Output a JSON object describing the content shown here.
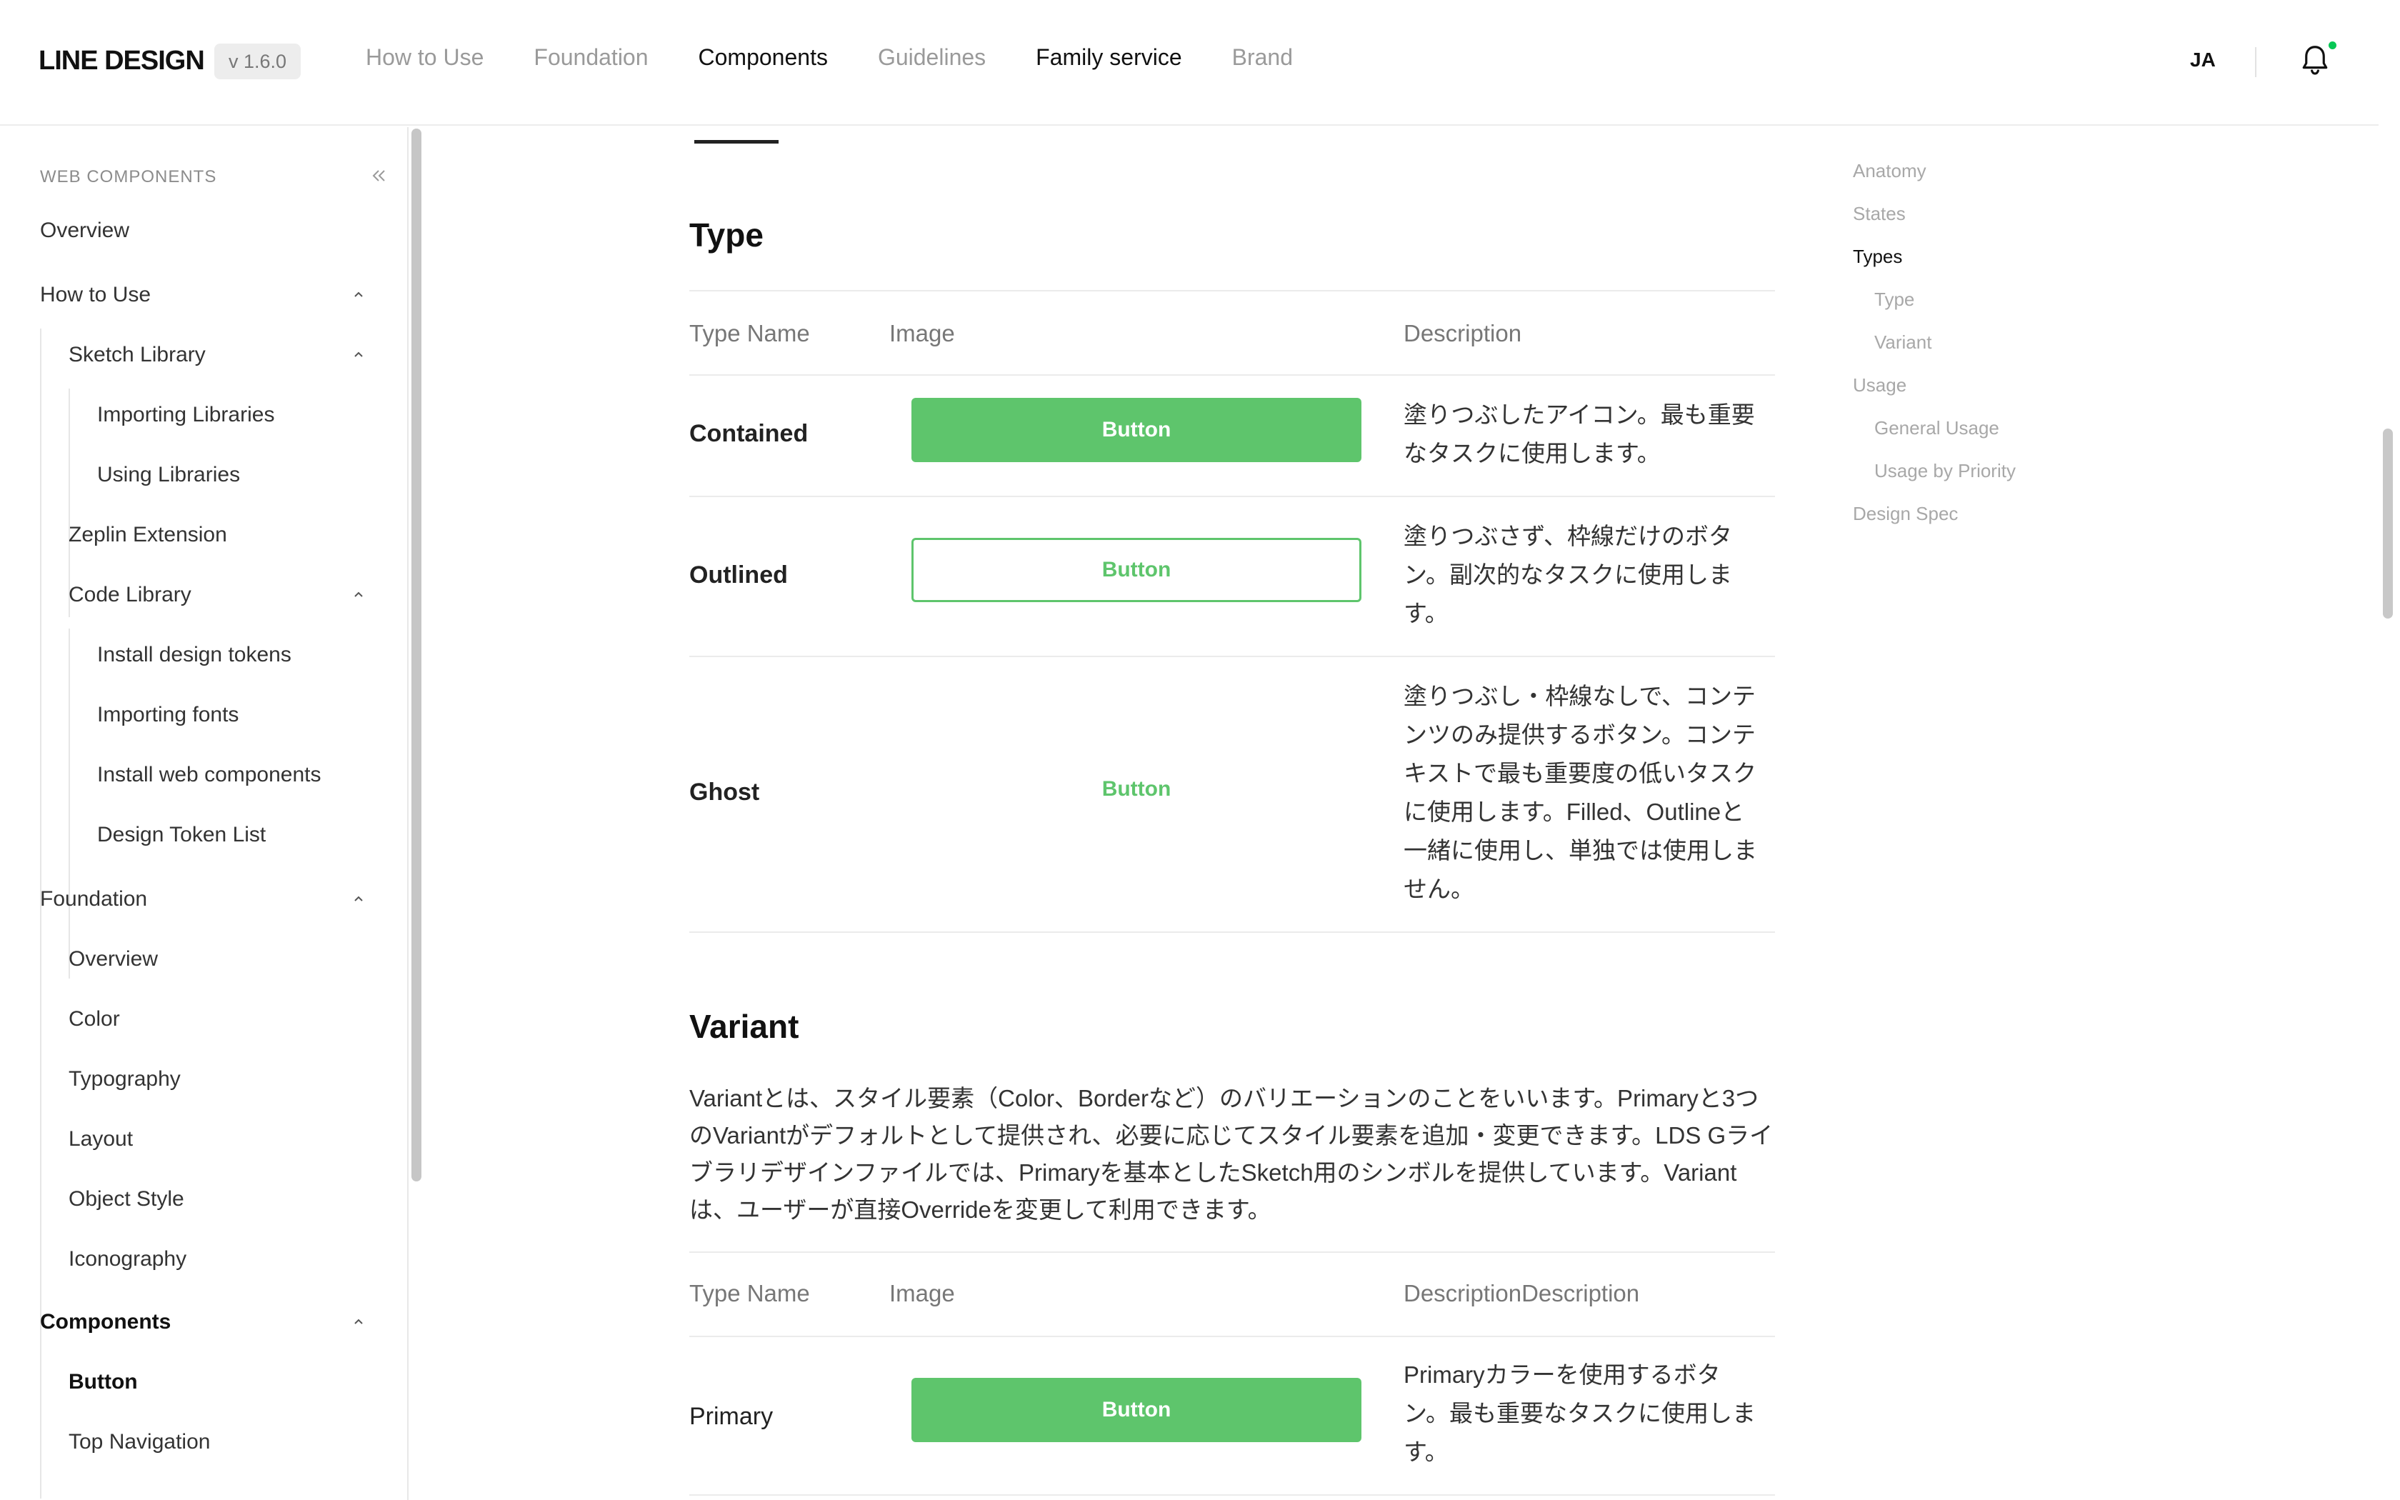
{
  "header": {
    "logo": "LINE DESIGN",
    "version": "v 1.6.0",
    "nav": [
      {
        "label": "How to Use",
        "active": false
      },
      {
        "label": "Foundation",
        "active": false
      },
      {
        "label": "Components",
        "active": true
      },
      {
        "label": "Guidelines",
        "active": false
      },
      {
        "label": "Family service",
        "active": true
      },
      {
        "label": "Brand",
        "active": false
      }
    ],
    "lang": "JA",
    "notification_icon": "bell-icon"
  },
  "sidebar": {
    "title": "WEB COMPONENTS",
    "collapse_icon": "double-chevron-left-icon",
    "items": {
      "overview": "Overview",
      "how_to_use": "How to Use",
      "sketch_library": "Sketch Library",
      "importing_libraries": "Importing Libraries",
      "using_libraries": "Using Libraries",
      "zeplin_extension": "Zeplin Extension",
      "code_library": "Code Library",
      "install_design_tokens": "Install design tokens",
      "importing_fonts": "Importing fonts",
      "install_web_components": "Install web components",
      "design_token_list": "Design Token List",
      "foundation": "Foundation",
      "f_overview": "Overview",
      "color": "Color",
      "typography": "Typography",
      "layout": "Layout",
      "object_style": "Object Style",
      "iconography": "Iconography",
      "components": "Components",
      "button": "Button",
      "top_navigation": "Top Navigation"
    }
  },
  "type_section": {
    "title": "Type",
    "headers": {
      "name": "Type Name",
      "image": "Image",
      "description": "Description"
    },
    "rows": [
      {
        "name": "Contained",
        "button": "Button",
        "description": "塗りつぶしたアイコン。最も重要なタスクに使用します。"
      },
      {
        "name": "Outlined",
        "button": "Button",
        "description": "塗りつぶさず、枠線だけのボタン。副次的なタスクに使用します。"
      },
      {
        "name": "Ghost",
        "button": "Button",
        "description": "塗りつぶし・枠線なしで、コンテンツのみ提供するボタン。コンテキストで最も重要度の低いタスクに使用します。Filled、Outlineと一緒に使用し、単独では使用しません。"
      }
    ]
  },
  "variant_section": {
    "title": "Variant",
    "paragraph": "Variantとは、スタイル要素（Color、Borderなど）のバリエーションのことをいいます。Primaryと3つのVariantがデフォルトとして提供され、必要に応じてスタイル要素を追加・変更できます。LDS Gライブラリデザインファイルでは、Primaryを基本としたSketch用のシンボルを提供しています。Variantは、ユーザーが直接Overrideを変更して利用できます。",
    "headers": {
      "name": "Type Name",
      "image": "Image",
      "description": "DescriptionDescription"
    },
    "rows": [
      {
        "name": "Primary",
        "button": "Button",
        "description": "Primaryカラーを使用するボタン。最も重要なタスクに使用します。"
      }
    ]
  },
  "toc": {
    "items": [
      {
        "label": "Anatomy",
        "active": false,
        "indent": false
      },
      {
        "label": "States",
        "active": false,
        "indent": false
      },
      {
        "label": "Types",
        "active": true,
        "indent": false
      },
      {
        "label": "Type",
        "active": false,
        "indent": true
      },
      {
        "label": "Variant",
        "active": false,
        "indent": true
      },
      {
        "label": "Usage",
        "active": false,
        "indent": false
      },
      {
        "label": "General Usage",
        "active": false,
        "indent": true
      },
      {
        "label": "Usage by Priority",
        "active": false,
        "indent": true
      },
      {
        "label": "Design Spec",
        "active": false,
        "indent": false
      }
    ]
  },
  "colors": {
    "accent": "#5ec56c",
    "notification_dot": "#06c755"
  }
}
